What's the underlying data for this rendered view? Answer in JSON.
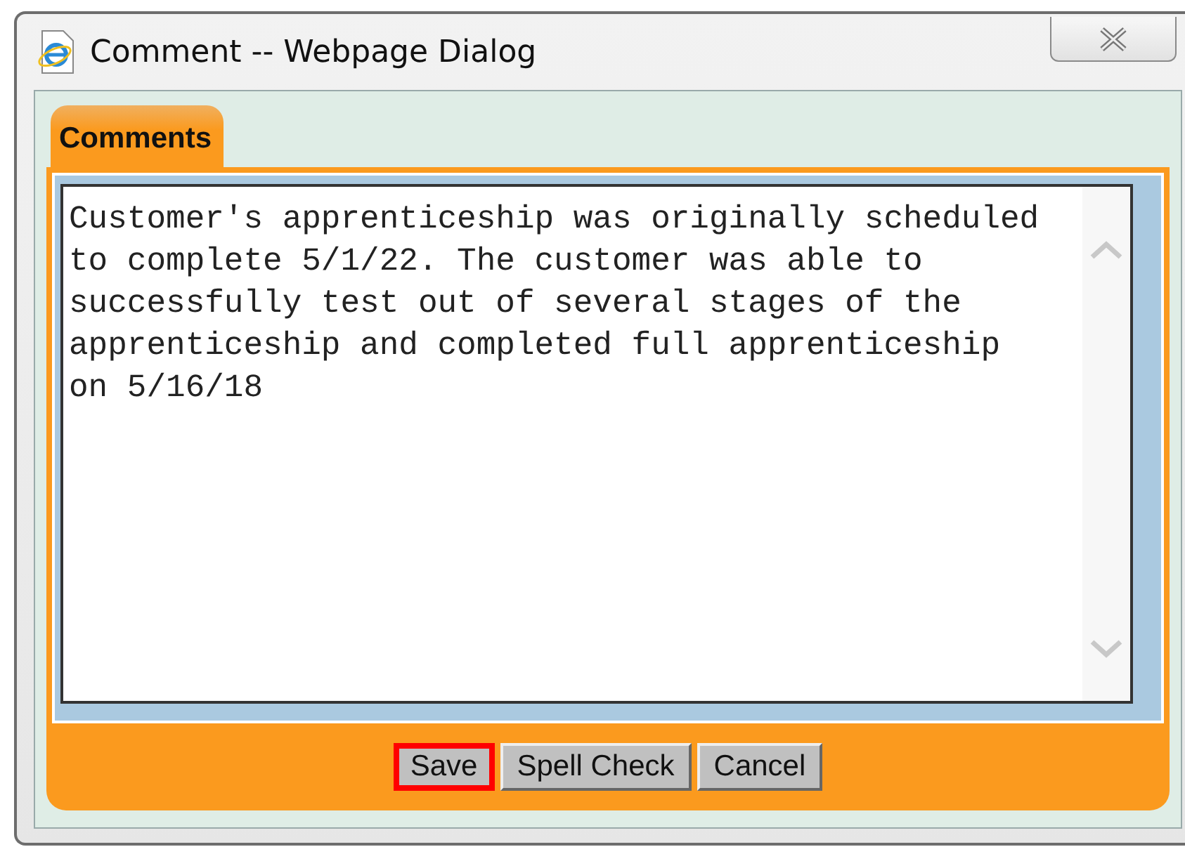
{
  "window": {
    "title": "Comment -- Webpage Dialog"
  },
  "tabs": [
    {
      "label": "Comments",
      "selected": true
    }
  ],
  "comment": {
    "value": "Customer's apprenticeship was originally scheduled to complete 5/1/22. The customer was able to successfully test out of several stages of the apprenticeship and completed full apprenticeship on 5/16/18"
  },
  "buttons": [
    {
      "label": "Save",
      "highlighted": true
    },
    {
      "label": "Spell Check",
      "highlighted": false
    },
    {
      "label": "Cancel",
      "highlighted": false
    }
  ]
}
